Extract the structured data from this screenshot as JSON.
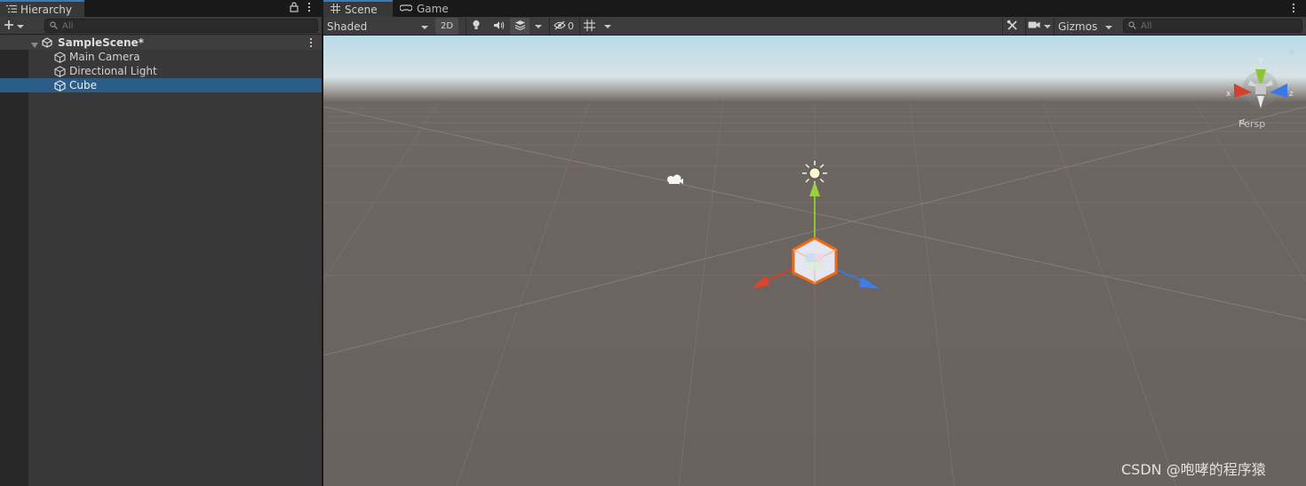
{
  "hierarchy": {
    "tab_label": "Hierarchy",
    "search_placeholder": "All",
    "scene_name": "SampleScene*",
    "items": [
      {
        "label": "Main Camera",
        "selected": false
      },
      {
        "label": "Directional Light",
        "selected": false
      },
      {
        "label": "Cube",
        "selected": true
      }
    ]
  },
  "scene_view": {
    "tabs": [
      {
        "label": "Scene",
        "icon": "grid-icon",
        "active": true
      },
      {
        "label": "Game",
        "icon": "gamepad-icon",
        "active": false
      }
    ],
    "toolbar": {
      "shading_mode": "Shaded",
      "mode_2d": "2D",
      "hidden_count": "0",
      "gizmos_label": "Gizmos",
      "search_placeholder": "All"
    },
    "projection_label": "Persp",
    "axis_labels": {
      "x": "x",
      "y": "y",
      "z": "z"
    },
    "watermark": "CSDN @咆哮的程序猿"
  },
  "colors": {
    "selection": "#2c5d87",
    "tab_accent": "#3a79bb",
    "axis_x": "#d4402a",
    "axis_y": "#8ac534",
    "axis_z": "#3b78e0",
    "selection_outline": "#f06a14"
  }
}
